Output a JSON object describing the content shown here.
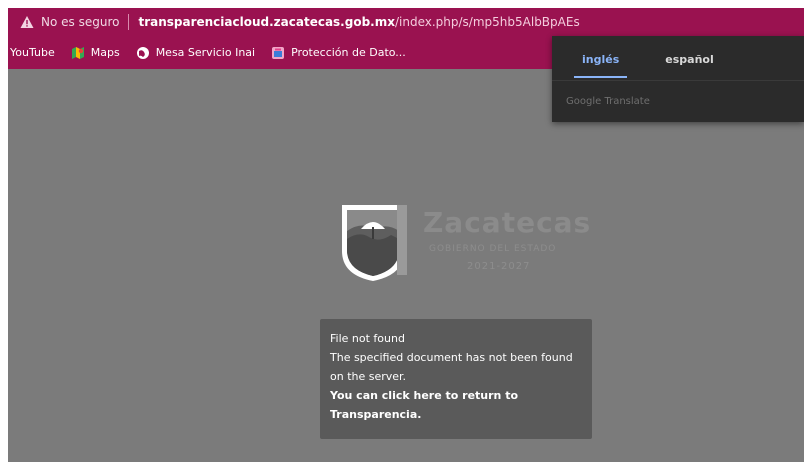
{
  "addressbar": {
    "security_label": "No es seguro",
    "url_host": "transparenciacloud.zacatecas.gob.mx",
    "url_path": "/index.php/s/mp5hb5AlbBpAEs"
  },
  "bookmarks": [
    {
      "label": "YouTube",
      "icon": "youtube-icon"
    },
    {
      "label": "Maps",
      "icon": "maps-icon"
    },
    {
      "label": "Mesa Servicio Inai",
      "icon": "globe-icon"
    },
    {
      "label": "Protección de Dato...",
      "icon": "bookmark-favicon-icon"
    }
  ],
  "translate": {
    "tab_english": "inglés",
    "tab_spanish": "español",
    "footer": "Google Translate",
    "accent": "#8ab4f8"
  },
  "logo": {
    "title": "Zacatecas",
    "subtitle": "GOBIERNO DEL ESTADO",
    "years": "2021-2027"
  },
  "error": {
    "title": "File not found",
    "message_line1": "The specified document has not been found",
    "message_line2": "on the server.",
    "return_link": "You can click here to return to Transparencia."
  },
  "colors": {
    "brand_bar": "#9a1250",
    "page_overlay": "#7b7b7b",
    "error_box": "#5a5a5a"
  }
}
